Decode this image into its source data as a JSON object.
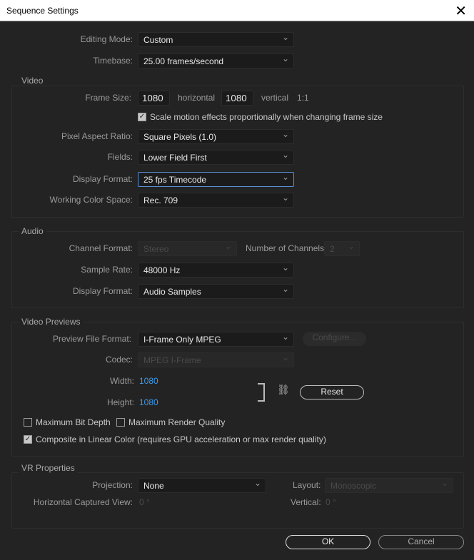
{
  "window": {
    "title": "Sequence Settings"
  },
  "general": {
    "editing_mode_label": "Editing Mode:",
    "editing_mode": "Custom",
    "timebase_label": "Timebase:",
    "timebase": "25.00  frames/second"
  },
  "video": {
    "title": "Video",
    "frame_size_label": "Frame Size:",
    "width": "1080",
    "horizontal": "horizontal",
    "height": "1080",
    "vertical": "vertical",
    "ratio": "1:1",
    "scale_motion": "Scale motion effects proportionally when changing frame size",
    "scale_motion_checked": true,
    "par_label": "Pixel Aspect Ratio:",
    "par": "Square Pixels (1.0)",
    "fields_label": "Fields:",
    "fields": "Lower Field First",
    "display_format_label": "Display Format:",
    "display_format": "25 fps Timecode",
    "color_space_label": "Working Color Space:",
    "color_space": "Rec. 709"
  },
  "audio": {
    "title": "Audio",
    "channel_format_label": "Channel Format:",
    "channel_format": "Stereo",
    "num_channels_label": "Number of Channels:",
    "num_channels": "2",
    "sample_rate_label": "Sample Rate:",
    "sample_rate": "48000 Hz",
    "display_format_label": "Display Format:",
    "display_format": "Audio Samples"
  },
  "previews": {
    "title": "Video Previews",
    "format_label": "Preview File Format:",
    "format": "I-Frame Only MPEG",
    "configure": "Configure...",
    "codec_label": "Codec:",
    "codec": "MPEG I-Frame",
    "width_label": "Width:",
    "width": "1080",
    "height_label": "Height:",
    "height": "1080",
    "reset": "Reset",
    "max_bit_depth": "Maximum Bit Depth",
    "max_render_quality": "Maximum Render Quality",
    "linear_color": "Composite in Linear Color (requires GPU acceleration or max render quality)"
  },
  "vr": {
    "title": "VR Properties",
    "projection_label": "Projection:",
    "projection": "None",
    "layout_label": "Layout:",
    "layout": "Monoscopic",
    "hview_label": "Horizontal Captured View:",
    "hview": "0 °",
    "vertical_label": "Vertical:",
    "vertical": "0 °"
  },
  "buttons": {
    "ok": "OK",
    "cancel": "Cancel"
  }
}
